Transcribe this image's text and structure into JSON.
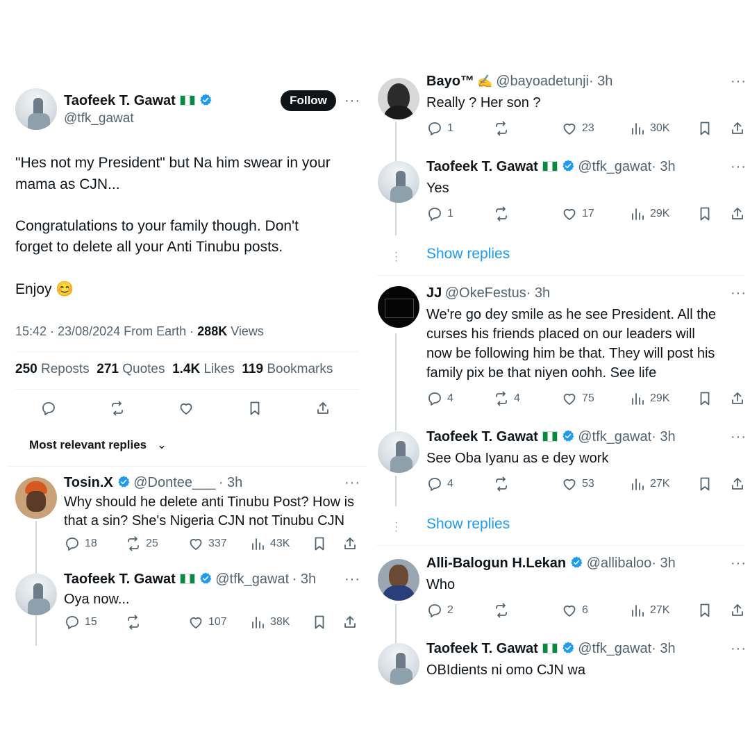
{
  "main_post": {
    "author_name": "Taofeek T. Gawat",
    "author_handle": "@tfk_gawat",
    "follow_label": "Follow",
    "text_line1": "\"Hes not my President\" but Na him swear in your",
    "text_line2": "mama as CJN...",
    "text_line3": "Congratulations to your family though. Don't",
    "text_line4": "forget to delete all your Anti Tinubu posts.",
    "text_line5": "Enjoy",
    "emoji": "😊",
    "timestamp": "15:42 · 23/08/2024 From Earth ·",
    "views_count": "288K",
    "views_label": "Views",
    "stats": {
      "reposts_count": "250",
      "reposts_label": "Reposts",
      "quotes_count": "271",
      "quotes_label": "Quotes",
      "likes_count": "1.4K",
      "likes_label": "Likes",
      "bookmarks_count": "119",
      "bookmarks_label": "Bookmarks"
    },
    "sort_label": "Most relevant replies"
  },
  "left_replies": [
    {
      "name": "Tosin.X",
      "handle": "@Dontee___",
      "time": "· 3h",
      "line1": "Why should he delete anti Tinubu Post? How is",
      "line2": "that a sin? She's Nigeria CJN not Tinubu CJN",
      "replies": "18",
      "reposts": "25",
      "likes": "337",
      "views": "43K"
    },
    {
      "name": "Taofeek T. Gawat",
      "handle": "@tfk_gawat",
      "time": "· 3h",
      "line1": "Oya now...",
      "replies": "15",
      "reposts": "",
      "likes": "107",
      "views": "38K"
    }
  ],
  "right_replies": [
    {
      "name": "Bayo™",
      "handle": "@bayoadetunji",
      "time": "· 3h",
      "line1": "Really ?  Her son ?",
      "replies": "1",
      "reposts": "",
      "likes": "23",
      "views": "30K"
    },
    {
      "name": "Taofeek T. Gawat",
      "handle": "@tfk_gawat",
      "time": "· 3h",
      "line1": "Yes",
      "replies": "1",
      "reposts": "",
      "likes": "17",
      "views": "29K"
    },
    {
      "name": "JJ",
      "handle": "@OkeFestus",
      "time": "· 3h",
      "line1": "We're go dey smile as he see President. All the",
      "line2": "curses his friends placed on our leaders will",
      "line3": "now be following him be that. They will post his",
      "line4": "family pix be that niyen oohh. See life",
      "replies": "4",
      "reposts": "4",
      "likes": "75",
      "views": "29K"
    },
    {
      "name": "Taofeek T. Gawat",
      "handle": "@tfk_gawat",
      "time": "· 3h",
      "line1": "See Oba Iyanu as e dey work",
      "replies": "4",
      "reposts": "",
      "likes": "53",
      "views": "27K"
    },
    {
      "name": "Alli-Balogun H.Lekan",
      "handle": "@allibaloo",
      "time": "· 3h",
      "line1": "Who",
      "replies": "2",
      "reposts": "",
      "likes": "6",
      "views": "27K"
    },
    {
      "name": "Taofeek T. Gawat",
      "handle": "@tfk_gawat",
      "time": "· 3h",
      "line1": "OBIdients ni omo CJN wa"
    }
  ],
  "show_replies_label": "Show replies",
  "more_glyph": "···",
  "colors": {
    "accent": "#1d9bf0",
    "text": "#0f1419",
    "muted": "#536471",
    "divider": "#eff3f4",
    "flag_green": "#0a8a3f"
  }
}
